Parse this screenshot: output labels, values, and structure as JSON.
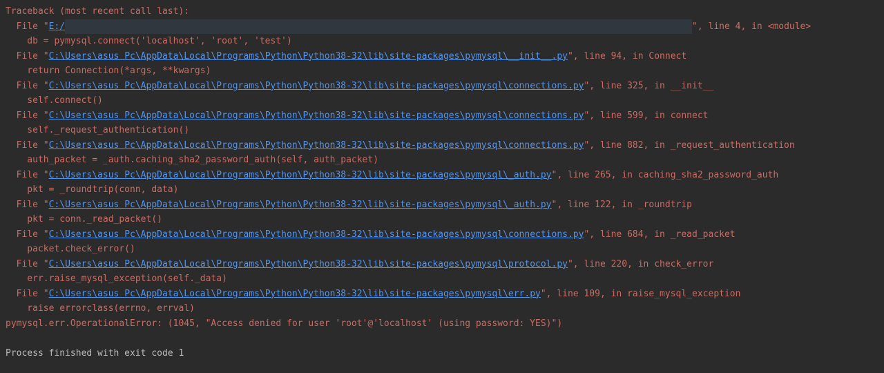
{
  "traceback": {
    "header": "Traceback (most recent call last):",
    "frames": [
      {
        "prefix": "  File \"",
        "path": "E:/",
        "redacted": "                                                                                                                    ",
        "suffix": "\", line 4, in <module>",
        "code": "    db = pymysql.connect('localhost', 'root', 'test')"
      },
      {
        "prefix": "  File \"",
        "path": "C:\\Users\\asus Pc\\AppData\\Local\\Programs\\Python\\Python38-32\\lib\\site-packages\\pymysql\\__init__.py",
        "suffix": "\", line 94, in Connect",
        "code": "    return Connection(*args, **kwargs)"
      },
      {
        "prefix": "  File \"",
        "path": "C:\\Users\\asus Pc\\AppData\\Local\\Programs\\Python\\Python38-32\\lib\\site-packages\\pymysql\\connections.py",
        "suffix": "\", line 325, in __init__",
        "code": "    self.connect()"
      },
      {
        "prefix": "  File \"",
        "path": "C:\\Users\\asus Pc\\AppData\\Local\\Programs\\Python\\Python38-32\\lib\\site-packages\\pymysql\\connections.py",
        "suffix": "\", line 599, in connect",
        "code": "    self._request_authentication()"
      },
      {
        "prefix": "  File \"",
        "path": "C:\\Users\\asus Pc\\AppData\\Local\\Programs\\Python\\Python38-32\\lib\\site-packages\\pymysql\\connections.py",
        "suffix": "\", line 882, in _request_authentication",
        "code": "    auth_packet = _auth.caching_sha2_password_auth(self, auth_packet)"
      },
      {
        "prefix": "  File \"",
        "path": "C:\\Users\\asus Pc\\AppData\\Local\\Programs\\Python\\Python38-32\\lib\\site-packages\\pymysql\\_auth.py",
        "suffix": "\", line 265, in caching_sha2_password_auth",
        "code": "    pkt = _roundtrip(conn, data)"
      },
      {
        "prefix": "  File \"",
        "path": "C:\\Users\\asus Pc\\AppData\\Local\\Programs\\Python\\Python38-32\\lib\\site-packages\\pymysql\\_auth.py",
        "suffix": "\", line 122, in _roundtrip",
        "code": "    pkt = conn._read_packet()"
      },
      {
        "prefix": "  File \"",
        "path": "C:\\Users\\asus Pc\\AppData\\Local\\Programs\\Python\\Python38-32\\lib\\site-packages\\pymysql\\connections.py",
        "suffix": "\", line 684, in _read_packet",
        "code": "    packet.check_error()"
      },
      {
        "prefix": "  File \"",
        "path": "C:\\Users\\asus Pc\\AppData\\Local\\Programs\\Python\\Python38-32\\lib\\site-packages\\pymysql\\protocol.py",
        "suffix": "\", line 220, in check_error",
        "code": "    err.raise_mysql_exception(self._data)"
      },
      {
        "prefix": "  File \"",
        "path": "C:\\Users\\asus Pc\\AppData\\Local\\Programs\\Python\\Python38-32\\lib\\site-packages\\pymysql\\err.py",
        "suffix": "\", line 109, in raise_mysql_exception",
        "code": "    raise errorclass(errno, errval)"
      }
    ],
    "exception": "pymysql.err.OperationalError: (1045, \"Access denied for user 'root'@'localhost' (using password: YES)\")"
  },
  "footer": "Process finished with exit code 1"
}
